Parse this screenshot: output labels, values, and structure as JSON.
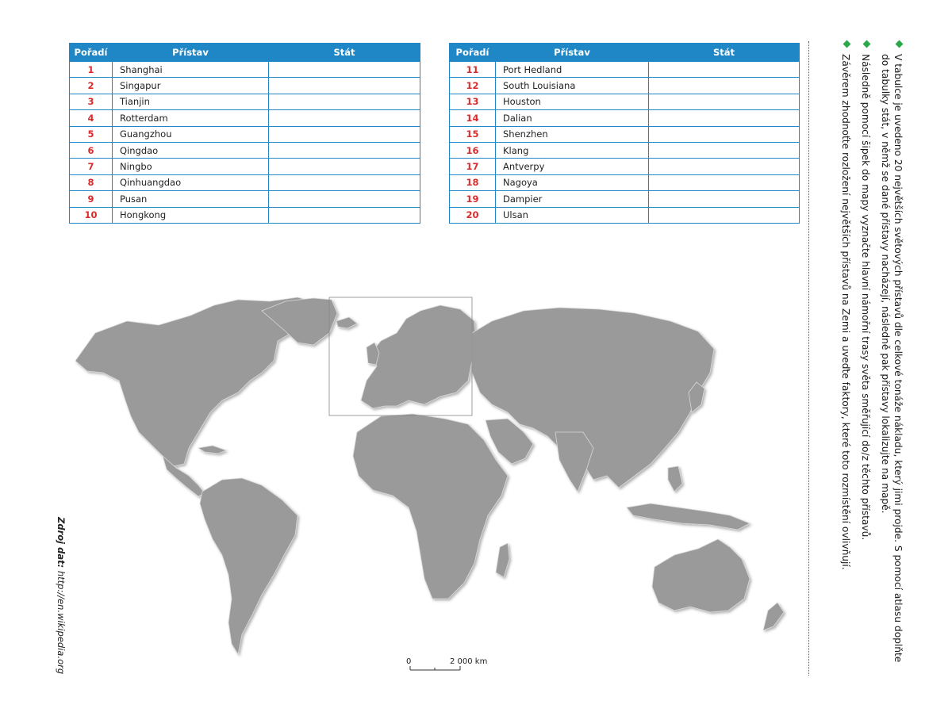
{
  "tables": {
    "left": {
      "headers": {
        "rank": "Pořadí",
        "port": "Přístav",
        "state": "Stát"
      },
      "rows": [
        {
          "rank": "1",
          "port": "Shanghai",
          "state": ""
        },
        {
          "rank": "2",
          "port": "Singapur",
          "state": ""
        },
        {
          "rank": "3",
          "port": "Tianjin",
          "state": ""
        },
        {
          "rank": "4",
          "port": "Rotterdam",
          "state": ""
        },
        {
          "rank": "5",
          "port": "Guangzhou",
          "state": ""
        },
        {
          "rank": "6",
          "port": "Qingdao",
          "state": ""
        },
        {
          "rank": "7",
          "port": "Ningbo",
          "state": ""
        },
        {
          "rank": "8",
          "port": "Qinhuangdao",
          "state": ""
        },
        {
          "rank": "9",
          "port": "Pusan",
          "state": ""
        },
        {
          "rank": "10",
          "port": "Hongkong",
          "state": ""
        }
      ]
    },
    "right": {
      "headers": {
        "rank": "Pořadí",
        "port": "Přístav",
        "state": "Stát"
      },
      "rows": [
        {
          "rank": "11",
          "port": "Port Hedland",
          "state": ""
        },
        {
          "rank": "12",
          "port": "South Louisiana",
          "state": ""
        },
        {
          "rank": "13",
          "port": "Houston",
          "state": ""
        },
        {
          "rank": "14",
          "port": "Dalian",
          "state": ""
        },
        {
          "rank": "15",
          "port": "Shenzhen",
          "state": ""
        },
        {
          "rank": "16",
          "port": "Klang",
          "state": ""
        },
        {
          "rank": "17",
          "port": "Antverpy",
          "state": ""
        },
        {
          "rank": "18",
          "port": "Nagoya",
          "state": ""
        },
        {
          "rank": "19",
          "port": "Dampier",
          "state": ""
        },
        {
          "rank": "20",
          "port": "Ulsan",
          "state": ""
        }
      ]
    }
  },
  "instructions": [
    "V tabulce je uvedeno 20 největších světových přístavů dle celkové tonáže nákladu, který jimi projde. S pomocí atlasu doplňte do tabulky stát, v němž se dané přístavy nacházejí, následně pak přístavy lokalizujte na mapě.",
    "Následně pomocí šipek do mapy vyznačte hlavní námořní trasy světa směřující do/z těchto přístavů.",
    "Závěrem zhodnoťte rozložení největších přístavů na Zemi a uveďte faktory, které toto rozmístění ovlivňují."
  ],
  "source": {
    "label": "Zdroj dat:",
    "url": "http://en.wikipedia.org"
  },
  "scale": {
    "start": "0",
    "end": "2 000 km"
  },
  "colors": {
    "header": "#1f87c6",
    "rank": "#d92b2b",
    "land": "#9a9a9a",
    "bullet": "#2aa84a"
  }
}
